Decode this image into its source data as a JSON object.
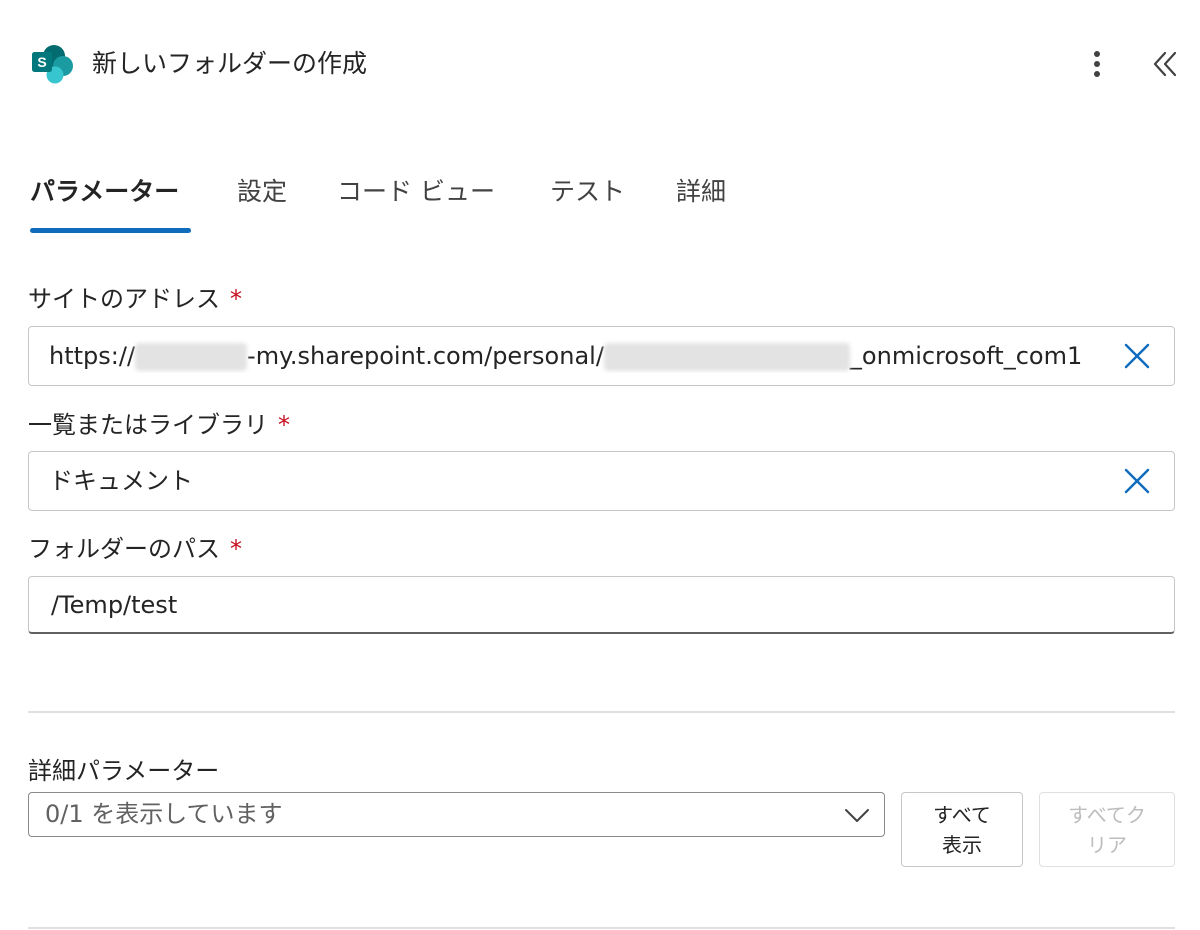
{
  "header": {
    "title": "新しいフォルダーの作成",
    "app_icon": "sharepoint-icon",
    "app_icon_letter": "S",
    "more_icon": "more-vertical-icon",
    "collapse_icon": "double-chevron-left-icon"
  },
  "tabs": [
    {
      "label": "パラメーター",
      "active": true
    },
    {
      "label": "設定",
      "active": false
    },
    {
      "label": "コード ビュー",
      "active": false
    },
    {
      "label": "テスト",
      "active": false
    },
    {
      "label": "詳細",
      "active": false
    }
  ],
  "fields": {
    "site_address": {
      "label": "サイトのアドレス",
      "required_mark": "*",
      "value_prefix": "https://",
      "value_middle": "-my.sharepoint.com/personal/",
      "value_suffix": "_onmicrosoft_com1"
    },
    "library": {
      "label": "一覧またはライブラリ",
      "required_mark": "*",
      "value": "ドキュメント"
    },
    "folder_path": {
      "label": "フォルダーのパス",
      "required_mark": "*",
      "value": "/Temp/test"
    }
  },
  "advanced": {
    "label": "詳細パラメーター",
    "select_value": "0/1 を表示しています",
    "show_all_line1": "すべて",
    "show_all_line2": "表示",
    "clear_all_line1": "すべてク",
    "clear_all_line2": "リア"
  },
  "colors": {
    "accent": "#0f6cbd",
    "clear_icon": "#0f6cbd",
    "required": "#c50f1f",
    "sharepoint_dark": "#036c70",
    "sharepoint_mid": "#1a9ba1",
    "sharepoint_light": "#37c6d0"
  }
}
